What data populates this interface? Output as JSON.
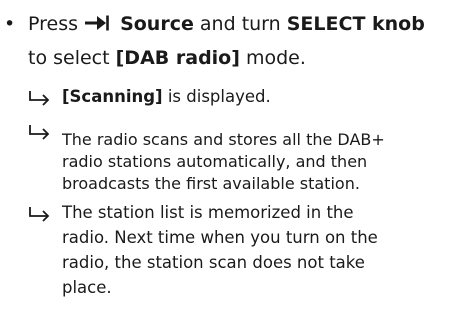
{
  "step": {
    "bullet": "•",
    "press_word": "Press",
    "source_label": "Source",
    "and_turn": "and turn",
    "knob_label": "SELECT knob",
    "to_select": "to select",
    "mode_label": "[DAB radio]",
    "mode_word": "mode."
  },
  "results": [
    {
      "lines": [
        "[Scanning] is displayed."
      ],
      "bold_prefix": "[Scanning]",
      "rest": " is displayed."
    },
    {
      "lines": [
        "The radio scans and stores all the DAB+",
        "radio stations automatically, and then",
        "broadcasts the first available station."
      ]
    },
    {
      "lines": [
        "The station list is memorized in the",
        "radio. Next time when you turn on the",
        "radio, the station scan does not take",
        "place."
      ]
    }
  ],
  "icons": {
    "source": "source-input-arrow-icon",
    "result_arrow": "result-arrow-icon"
  }
}
